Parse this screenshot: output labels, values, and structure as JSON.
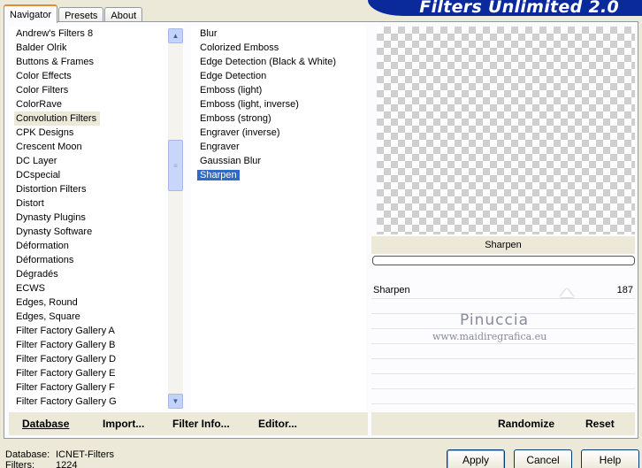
{
  "tabs": [
    "Navigator",
    "Presets",
    "About"
  ],
  "banner": "Filters Unlimited 2.0",
  "categories": [
    "Andrew's Filters 8",
    "Balder Olrik",
    "Buttons & Frames",
    "Color Effects",
    "Color Filters",
    "ColorRave",
    "Convolution Filters",
    "CPK Designs",
    "Crescent Moon",
    "DC Layer",
    "DCspecial",
    "Distortion Filters",
    "Distort",
    "Dynasty Plugins",
    "Dynasty Software",
    "Déformation",
    "Déformations",
    "Dégradés",
    "ECWS",
    "Edges, Round",
    "Edges, Square",
    "Filter Factory Gallery A",
    "Filter Factory Gallery B",
    "Filter Factory Gallery D",
    "Filter Factory Gallery E",
    "Filter Factory Gallery F",
    "Filter Factory Gallery G"
  ],
  "selected_category_index": 6,
  "filters": [
    "Blur",
    "Colorized Emboss",
    "Edge Detection (Black & White)",
    "Edge Detection",
    "Emboss (light)",
    "Emboss (light, inverse)",
    "Emboss (strong)",
    "Engraver (inverse)",
    "Engraver",
    "Gaussian Blur",
    "Sharpen"
  ],
  "selected_filter_index": 10,
  "preview_filter_name": "Sharpen",
  "parameter": {
    "label": "Sharpen",
    "value": "187"
  },
  "watermark": {
    "line1": "Pinuccia",
    "line2": "www.maidiregrafica.eu"
  },
  "bottom": {
    "database_left": "Database",
    "import_btn": "Import...",
    "filter_info_btn": "Filter Info...",
    "editor_btn": "Editor...",
    "randomize_btn": "Randomize",
    "reset_btn": "Reset"
  },
  "status": {
    "database_label": "Database:",
    "database_value": "ICNET-Filters",
    "filters_label": "Filters:",
    "filters_value": "1224"
  },
  "buttons": {
    "apply": "Apply",
    "cancel": "Cancel",
    "help": "Help"
  },
  "icons": {
    "scroll_up": "scroll-up-arrow-icon",
    "scroll_down": "scroll-down-arrow-icon",
    "scroll_thumb": "scroll-grip-icon"
  }
}
